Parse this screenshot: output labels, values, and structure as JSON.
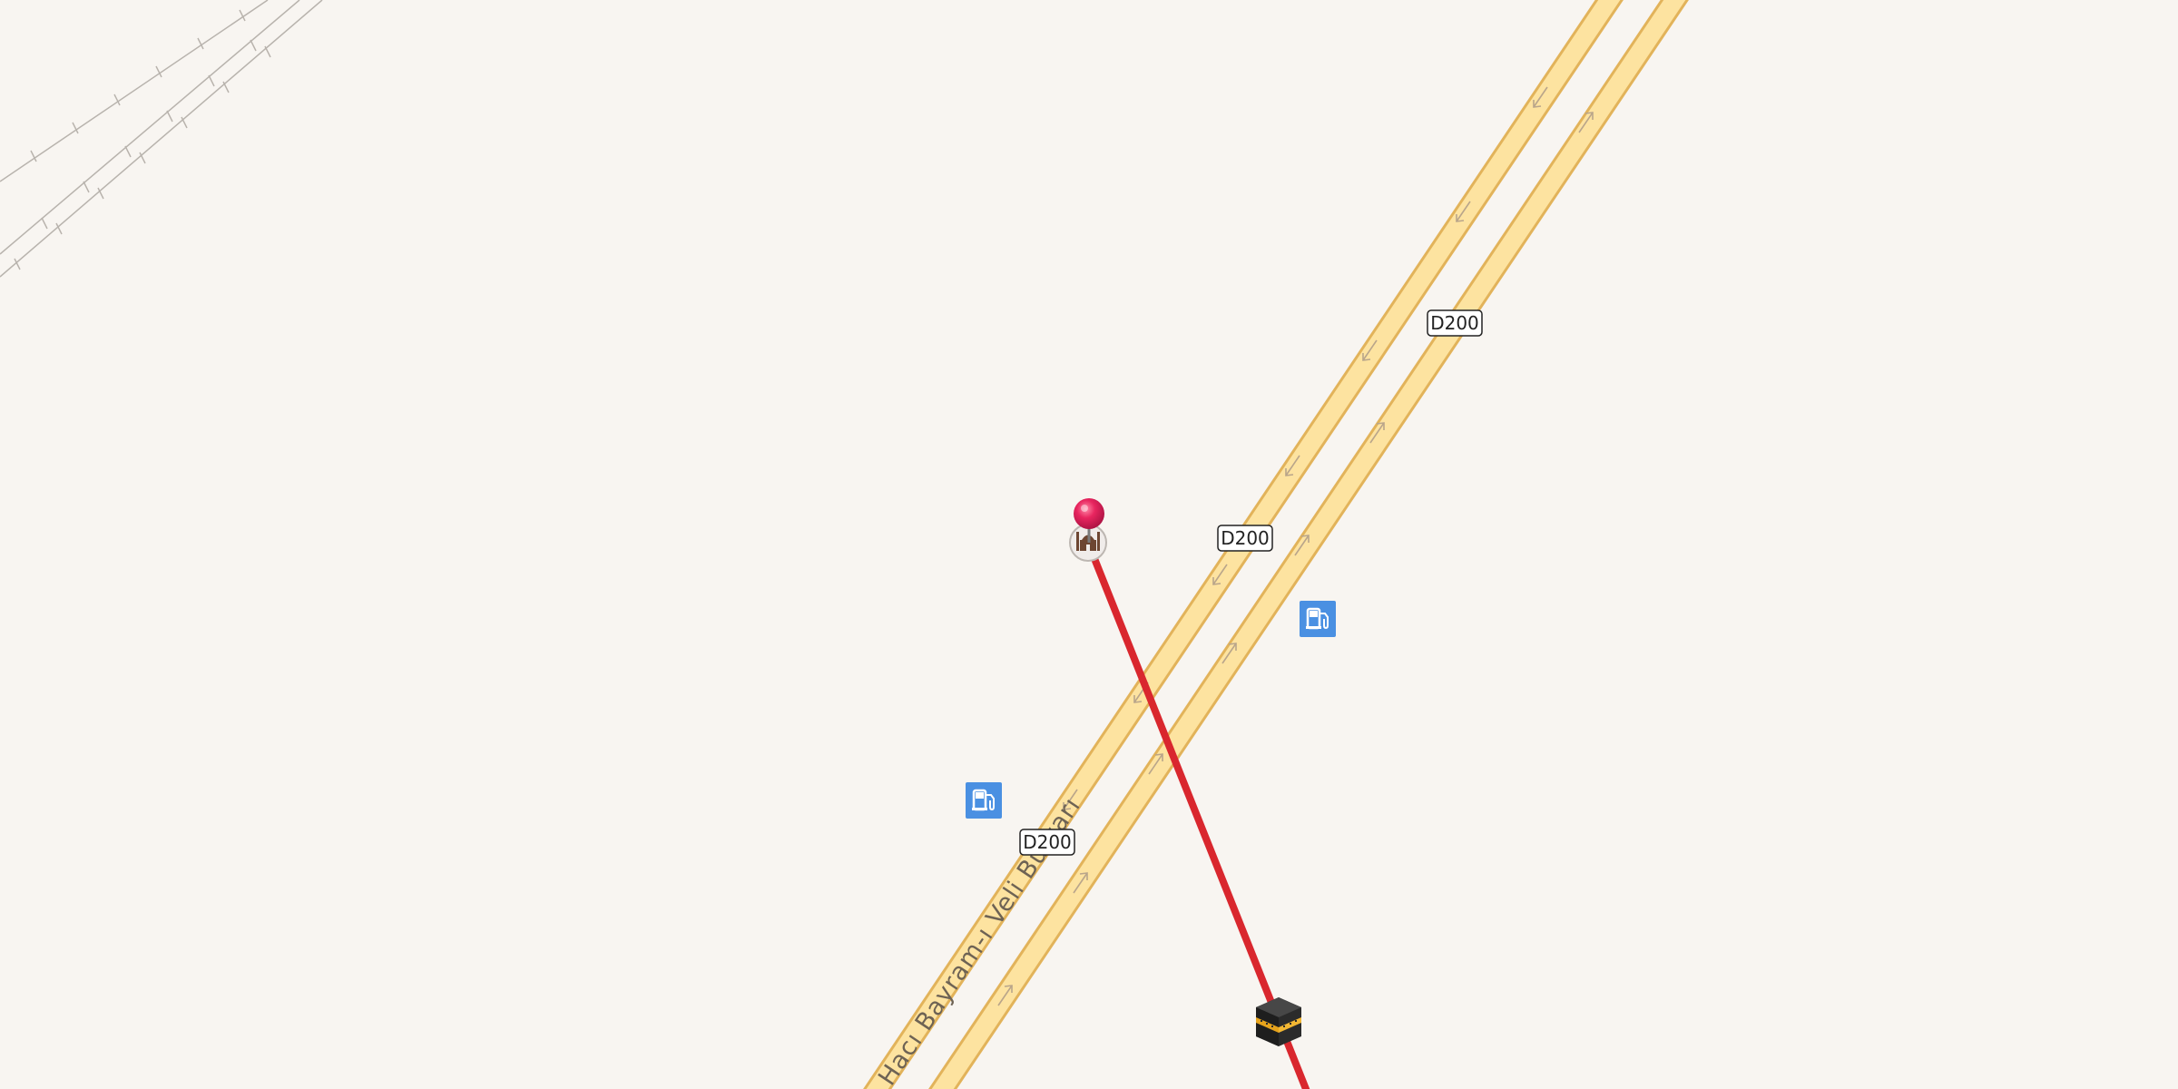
{
  "map": {
    "background_color": "#f8f5f1",
    "road_fill_color": "#fde3a0",
    "road_casing_color": "#e7b75c",
    "route_color": "#d9272e",
    "pin_color": "#e8255f",
    "poi_fuel_color": "#4a90e2"
  },
  "roads": {
    "highway_ref_1": "D200",
    "highway_ref_2": "D200",
    "highway_ref_3": "D200",
    "street_name": "Hacı Bayram-ı Veli Bulvarı"
  },
  "markers": {
    "selected_pin": "location-pin-icon",
    "mosque_poi": "mosque-icon",
    "fuel_poi_1": "fuel-station-icon",
    "fuel_poi_2": "fuel-station-icon",
    "destination": "kaaba-icon"
  }
}
